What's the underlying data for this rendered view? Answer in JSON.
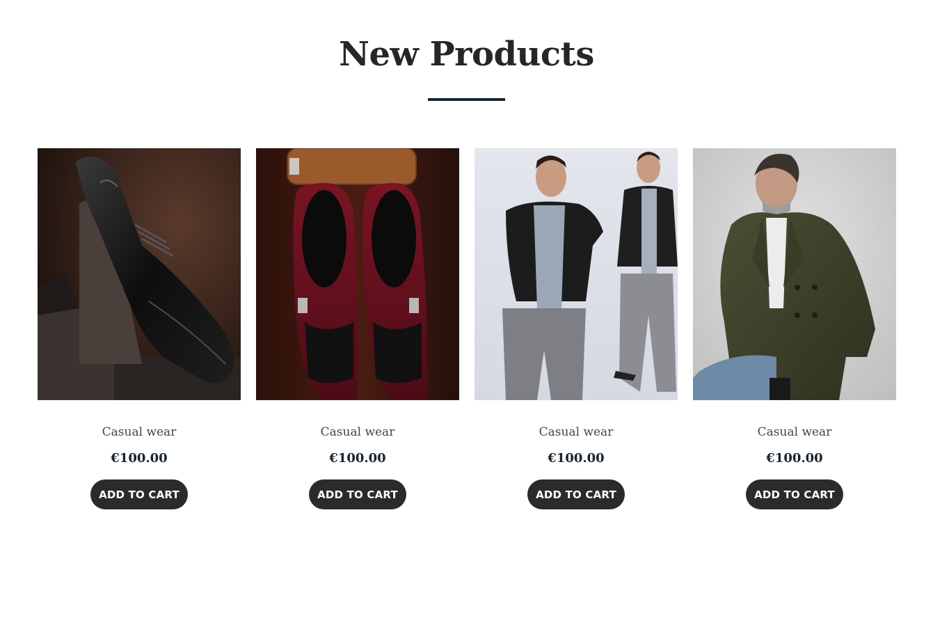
{
  "section": {
    "title": "New Products"
  },
  "products": [
    {
      "name": "Casual wear",
      "price": "€100.00",
      "button_label": "ADD TO CART"
    },
    {
      "name": "Casual wear",
      "price": "€100.00",
      "button_label": "ADD TO CART"
    },
    {
      "name": "Casual wear",
      "price": "€100.00",
      "button_label": "ADD TO CART"
    },
    {
      "name": "Casual wear",
      "price": "€100.00",
      "button_label": "ADD TO CART"
    }
  ],
  "colors": {
    "accent": "#142634",
    "button": "#2b2b2b",
    "background": "#ffffff"
  }
}
